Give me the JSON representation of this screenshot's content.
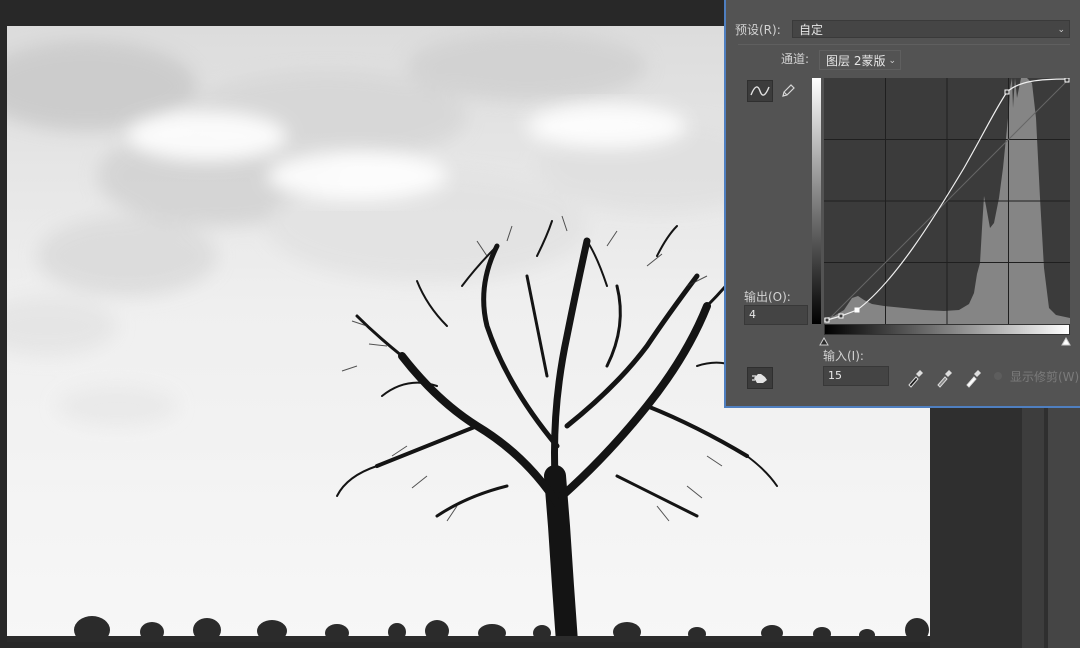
{
  "panel": {
    "preset_label": "预设(R):",
    "preset_value": "自定",
    "channel_label": "通道:",
    "channel_value": "图层 2蒙版",
    "output_label": "输出(O):",
    "output_value": "4",
    "input_label": "输入(I):",
    "input_value": "15",
    "show_clipping_label": "显示修剪(W)"
  },
  "icons": {
    "curve_tool": "curve-point-icon",
    "pencil_tool": "pencil-icon",
    "on_image_adjust": "hand-adjust-icon",
    "black_point": "black-eyedropper-icon",
    "gray_point": "gray-eyedropper-icon",
    "white_point": "white-eyedropper-icon",
    "dropdown": "chevron-down-icon"
  },
  "colors": {
    "panel_bg": "#535353",
    "graph_bg": "#3b3b3b",
    "histogram": "#858585",
    "curve": "#f0f0f0",
    "panel_border": "#4f7fc0"
  }
}
